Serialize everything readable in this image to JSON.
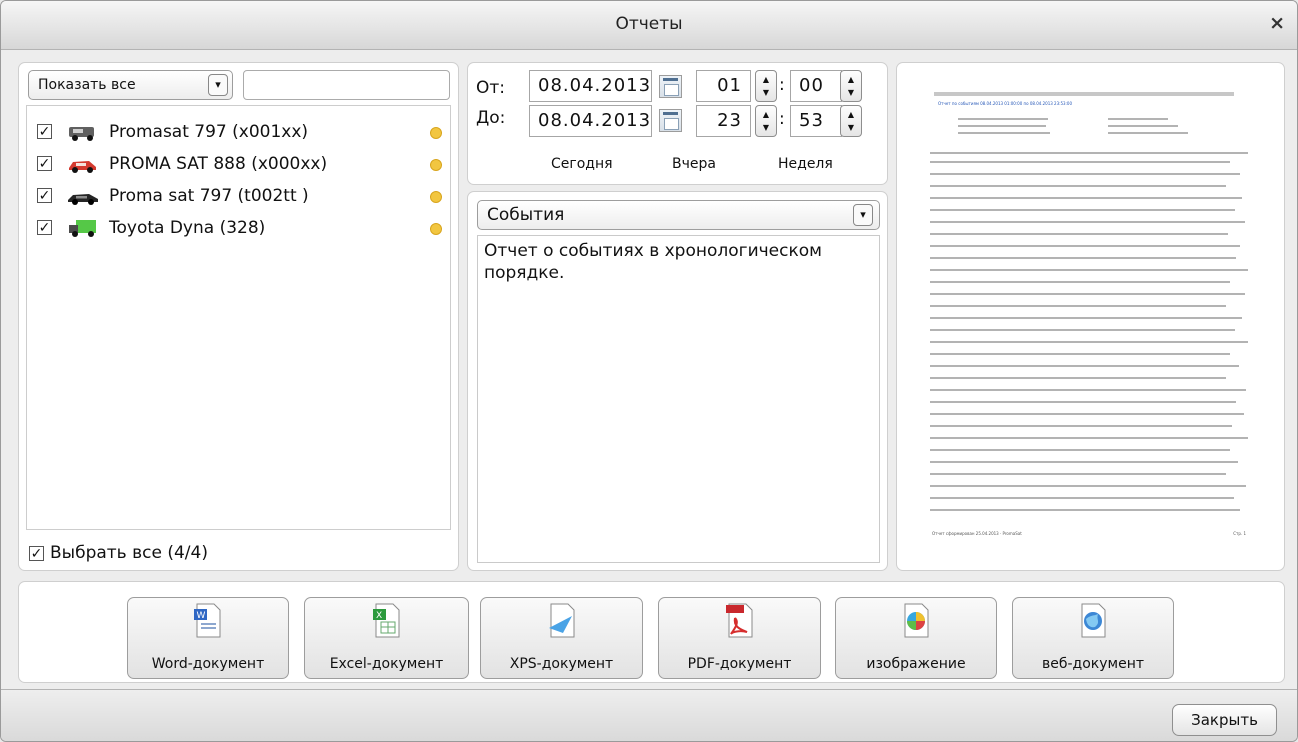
{
  "window": {
    "title": "Отчеты",
    "close_symbol": "×"
  },
  "left_panel": {
    "show_filter": "Показать все",
    "filter_arrow": "▾",
    "vehicles": [
      {
        "label": "Promasat 797 (x001xx)",
        "checked": true,
        "icon": "van-icon",
        "color": "#5b5b5b"
      },
      {
        "label": "PROMA SAT  888 (x000xx)",
        "checked": true,
        "icon": "car-red-icon",
        "color": "#d43a2f"
      },
      {
        "label": "Proma sat 797 (t002tt )",
        "checked": true,
        "icon": "car-black-icon",
        "color": "#222222"
      },
      {
        "label": "Toyota Dyna (328)",
        "checked": true,
        "icon": "truck-green-icon",
        "color": "#59c645"
      }
    ],
    "select_all_label": "Выбрать все (4/4)",
    "checkmark": "✓"
  },
  "date_panel": {
    "from_label": "От:",
    "to_label": "До:",
    "from_date": "08.04.2013",
    "from_hour": "01",
    "from_minute": "00",
    "to_date": "08.04.2013",
    "to_hour": "23",
    "to_minute": "53",
    "colon": ":",
    "today": "Сегодня",
    "yesterday": "Вчера",
    "week": "Неделя"
  },
  "report_panel": {
    "report_type": "События",
    "description": "Отчет о событиях в хронологическом порядке."
  },
  "preview": {
    "title": "Отчет по событиям 08.04.2013 01:00:00 по 08.04.2013 23:53:00",
    "footer": "Отчет сформирован  25.04.2013  ·  PromaSat",
    "page_no": "Стр. 1"
  },
  "export_buttons": [
    {
      "label": "Word-документ",
      "icon": "word-document-icon"
    },
    {
      "label": "Excel-документ",
      "icon": "excel-document-icon"
    },
    {
      "label": "XPS-документ",
      "icon": "xps-document-icon"
    },
    {
      "label": "PDF-документ",
      "icon": "pdf-document-icon"
    },
    {
      "label": "изображение",
      "icon": "image-icon"
    },
    {
      "label": "веб-документ",
      "icon": "web-document-icon"
    }
  ],
  "footer": {
    "close_label": "Закрыть"
  }
}
